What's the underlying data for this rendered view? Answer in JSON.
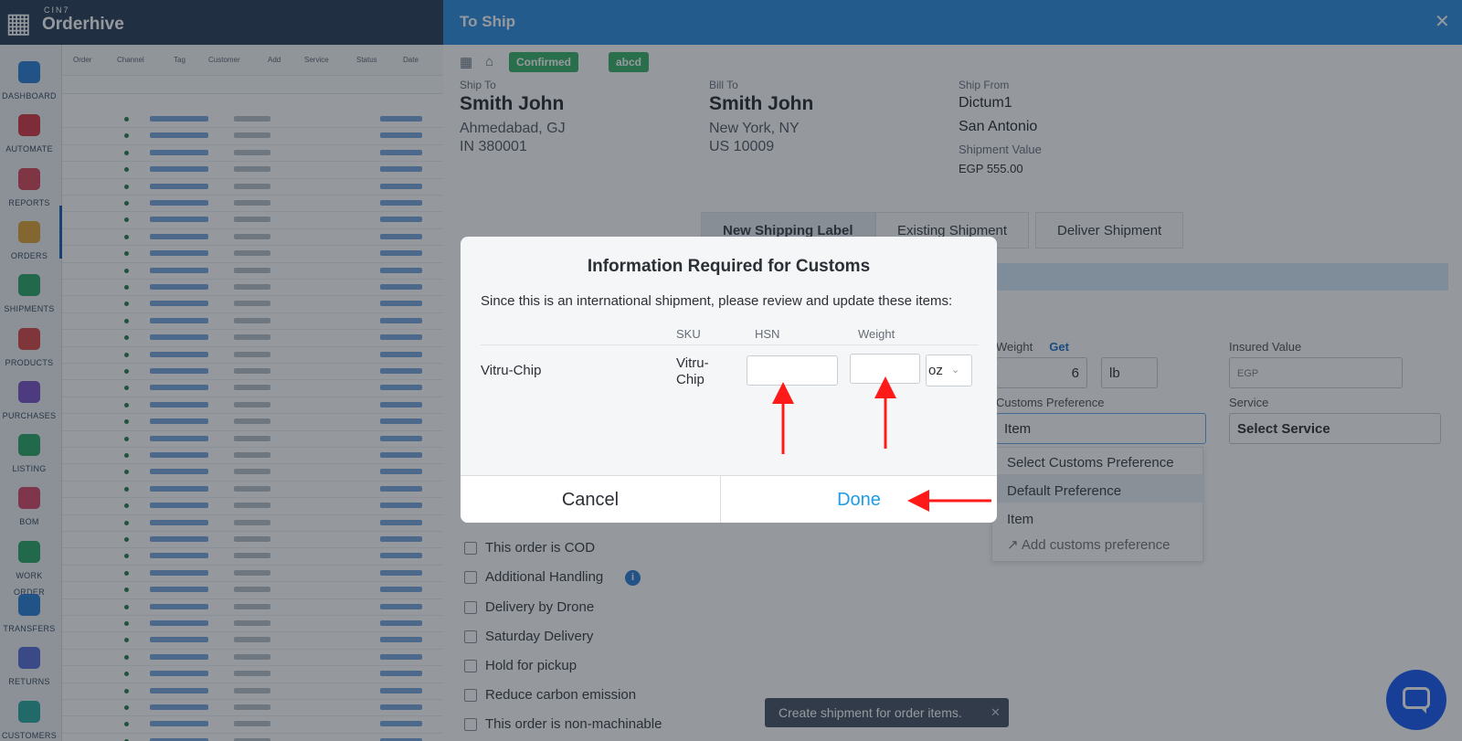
{
  "brand": {
    "top": "CIN7",
    "name": "Orderhive"
  },
  "nav": [
    {
      "label": "DASHBOARD",
      "color": "#2f80d6"
    },
    {
      "label": "AUTOMATE",
      "color": "#d83a4a"
    },
    {
      "label": "REPORTS",
      "color": "#d8495c"
    },
    {
      "label": "ORDERS",
      "color": "#e0a23a"
    },
    {
      "label": "SHIPMENTS",
      "color": "#2ea86a"
    },
    {
      "label": "PRODUCTS",
      "color": "#d84a4a"
    },
    {
      "label": "PURCHASES",
      "color": "#7b57c9"
    },
    {
      "label": "LISTING",
      "color": "#2ea86a"
    },
    {
      "label": "BOM",
      "color": "#d84a6a"
    },
    {
      "label": "WORK ORDER",
      "color": "#2ea86a"
    },
    {
      "label": "TRANSFERS",
      "color": "#2f80d6"
    },
    {
      "label": "RETURNS",
      "color": "#5a6fd8"
    },
    {
      "label": "CUSTOMERS",
      "color": "#2ea8a0"
    }
  ],
  "panel": {
    "title": "To Ship",
    "close_glyph": "✕",
    "tags": [
      {
        "label": "Confirmed",
        "color": "#3db36a"
      },
      {
        "label": "abcd",
        "color": "#3db36a"
      }
    ],
    "ship_to": {
      "label": "Ship To",
      "name": "Smith John",
      "line1": "Ahmedabad, GJ",
      "line2": "IN 380001"
    },
    "bill_to": {
      "label": "Bill To",
      "name": "Smith John",
      "line1": "New York, NY",
      "line2": "US 10009"
    },
    "ship_from": {
      "label": "Ship From",
      "name": "Dictum1",
      "location": "San Antonio",
      "value_label": "Shipment Value",
      "value": "EGP 555.00"
    },
    "tabs": [
      "New Shipping Label",
      "Existing Shipment",
      "Deliver Shipment"
    ],
    "weight": {
      "label": "Weight",
      "get": "Get",
      "value": "6",
      "unit": "lb"
    },
    "insured": {
      "label": "Insured Value",
      "placeholder": "EGP"
    },
    "customs": {
      "label": "Customs Preference",
      "value": "Item"
    },
    "service": {
      "label": "Service",
      "value": "Select Service"
    },
    "customs_options": [
      "Select Customs Preference",
      "Default Preference",
      "Item",
      "Add customs preference"
    ],
    "checkboxes": [
      "This order is COD",
      "Additional Handling",
      "Delivery by Drone",
      "Saturday Delivery",
      "Hold for pickup",
      "Reduce carbon emission",
      "This order is non-machinable"
    ],
    "toast": "Create shipment for order items."
  },
  "modal": {
    "title": "Information Required for Customs",
    "message": "Since this is an international shipment, please review and update these items:",
    "col_sku": "SKU",
    "col_hsn": "HSN",
    "col_weight": "Weight",
    "item": {
      "name": "Vitru-Chip",
      "sku": "Vitru-Chip",
      "hsn": "",
      "weight": "",
      "unit": "oz"
    },
    "cancel": "Cancel",
    "done": "Done"
  },
  "colors": {
    "header": "#2f8fe0",
    "done_text": "#1e9be9",
    "annotation_arrow": "#ff1a1a"
  }
}
